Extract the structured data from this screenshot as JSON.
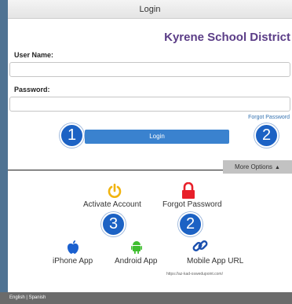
{
  "window": {
    "title": "Login"
  },
  "header": {
    "district": "Kyrene School District"
  },
  "form": {
    "username_label": "User Name:",
    "username_value": "",
    "password_label": "Password:",
    "password_value": "",
    "forgot_link": "Forgot Password",
    "login_label": "Login"
  },
  "badges": {
    "one": "1",
    "two": "2",
    "three": "3"
  },
  "more_options": {
    "label": "More Options"
  },
  "options": {
    "activate": {
      "label": "Activate Account",
      "icon": "power-icon",
      "color": "#f1b40f"
    },
    "forgot": {
      "label": "Forgot Password",
      "icon": "lock-icon",
      "color": "#e8202a"
    },
    "iphone": {
      "label": "iPhone App",
      "icon": "apple-icon",
      "color": "#1a60cf"
    },
    "android": {
      "label": "Android App",
      "icon": "android-icon",
      "color": "#3fbe2f"
    },
    "mobile_url": {
      "label": "Mobile Mobile App URL",
      "icon": "link-icon",
      "color": "#1a4fae"
    }
  },
  "mobile_url_text": "https://az-kad-oswedupoint.com/",
  "footer": {
    "english": "English",
    "divider": "|",
    "spanish": "Spanish"
  },
  "colors": {
    "accent": "#3a82cf",
    "badge": "#1c62c4",
    "district": "#5b3d87"
  }
}
